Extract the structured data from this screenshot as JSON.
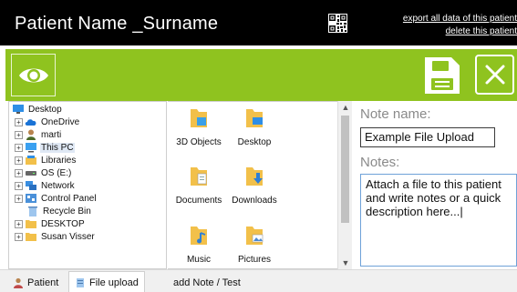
{
  "header": {
    "patient_name": "Patient Name _Surname",
    "export_link": "export all data of this patient",
    "delete_link": "delete this patient"
  },
  "toolbar": {
    "view_icon": "eye-icon",
    "save_icon": "save-icon",
    "close_icon": "close-icon",
    "accent_color": "#8fc31f"
  },
  "tree": {
    "items": [
      {
        "label": "Desktop",
        "icon": "desktop-icon"
      },
      {
        "label": "OneDrive",
        "icon": "cloud-icon"
      },
      {
        "label": "marti",
        "icon": "user-icon"
      },
      {
        "label": "This PC",
        "icon": "monitor-icon"
      },
      {
        "label": "Libraries",
        "icon": "library-icon"
      },
      {
        "label": "OS (E:)",
        "icon": "drive-icon"
      },
      {
        "label": "Network",
        "icon": "network-icon"
      },
      {
        "label": "Control Panel",
        "icon": "control-panel-icon"
      },
      {
        "label": "Recycle Bin",
        "icon": "recycle-bin-icon"
      },
      {
        "label": "DESKTOP",
        "icon": "folder-icon"
      },
      {
        "label": "Susan Visser",
        "icon": "folder-icon"
      }
    ]
  },
  "files": {
    "items": [
      {
        "label": "3D Objects",
        "icon": "3d-objects-folder-icon"
      },
      {
        "label": "Desktop",
        "icon": "desktop-folder-icon"
      },
      {
        "label": "Documents",
        "icon": "documents-folder-icon"
      },
      {
        "label": "Downloads",
        "icon": "downloads-folder-icon"
      },
      {
        "label": "Music",
        "icon": "music-folder-icon"
      },
      {
        "label": "Pictures",
        "icon": "pictures-folder-icon"
      }
    ]
  },
  "note": {
    "name_label": "Note name:",
    "name_value": "Example File Upload",
    "notes_label": "Notes:",
    "notes_value": "Attach a file to this patient and write notes or a quick description here...|"
  },
  "tabs": [
    {
      "label": "Patient"
    },
    {
      "label": "File upload"
    },
    {
      "label": "add Note / Test"
    }
  ]
}
